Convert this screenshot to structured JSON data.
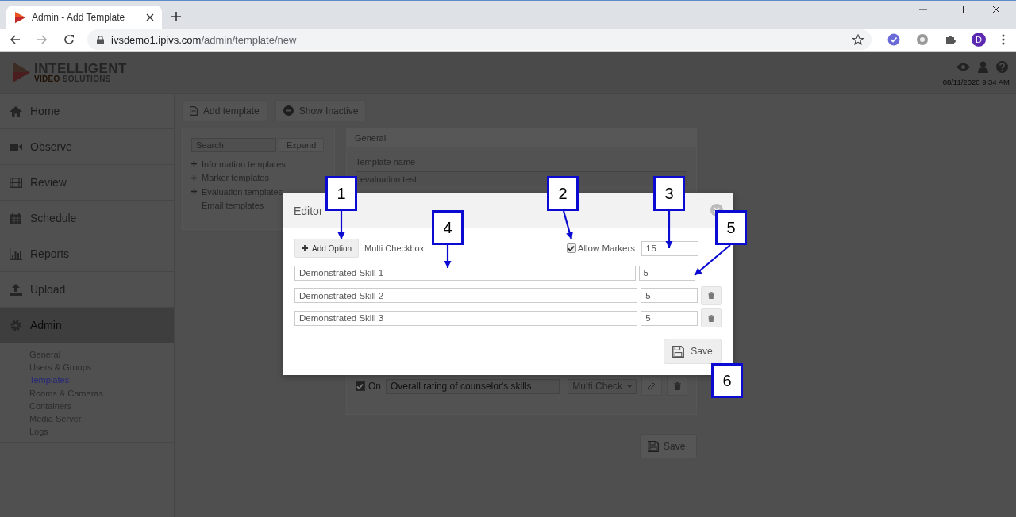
{
  "browser": {
    "tab_title": "Admin - Add Template",
    "url_host": "ivsdemo1.ipivs.com",
    "url_path": "/admin/template/new",
    "avatar": "D"
  },
  "header": {
    "brand_top": "INTELLIGENT",
    "brand_accent": "VIDEO",
    "brand_rest": "SOLUTIONS",
    "datetime": "08/11/2020 9:34 AM"
  },
  "sidebar": {
    "items": [
      {
        "label": "Home",
        "selected": false
      },
      {
        "label": "Observe",
        "selected": false
      },
      {
        "label": "Review",
        "selected": false
      },
      {
        "label": "Schedule",
        "selected": false
      },
      {
        "label": "Reports",
        "selected": false
      },
      {
        "label": "Upload",
        "selected": false
      },
      {
        "label": "Admin",
        "selected": true
      }
    ],
    "subitems": [
      {
        "label": "General",
        "selected": false
      },
      {
        "label": "Users & Groups",
        "selected": false
      },
      {
        "label": "Templates",
        "selected": true
      },
      {
        "label": "Rooms & Cameras",
        "selected": false
      },
      {
        "label": "Containers",
        "selected": false
      },
      {
        "label": "Media Server",
        "selected": false
      },
      {
        "label": "Logs",
        "selected": false
      }
    ]
  },
  "toolbar": {
    "add_template": "Add template",
    "show_inactive": "Show Inactive"
  },
  "tree": {
    "search_placeholder": "Search",
    "expand": "Expand",
    "items": [
      {
        "label": "Information templates",
        "expandable": true
      },
      {
        "label": "Marker templates",
        "expandable": true
      },
      {
        "label": "Evaluation templates",
        "expandable": true
      },
      {
        "label": "Email templates",
        "expandable": false
      }
    ]
  },
  "general": {
    "title": "General",
    "name_label": "Template name",
    "name_value": "evaluation test",
    "question": {
      "checked": true,
      "on_label": "On",
      "text": "Overall rating of counselor's skills",
      "type": "Multi Check"
    },
    "save": "Save"
  },
  "modal": {
    "title": "Editor",
    "add_option": "Add Option",
    "type_label": "Multi Checkbox",
    "allow_markers": {
      "label": "Allow Markers",
      "checked": true
    },
    "marker_total": "15",
    "options": [
      {
        "text": "Demonstrated Skill 1",
        "value": "5",
        "deletable": false
      },
      {
        "text": "Demonstrated Skill 2",
        "value": "5",
        "deletable": true
      },
      {
        "text": "Demonstrated Skill 3",
        "value": "5",
        "deletable": true
      }
    ],
    "save": "Save"
  },
  "callouts": [
    {
      "label": "1"
    },
    {
      "label": "2"
    },
    {
      "label": "3"
    },
    {
      "label": "4"
    },
    {
      "label": "5"
    },
    {
      "label": "6"
    }
  ]
}
